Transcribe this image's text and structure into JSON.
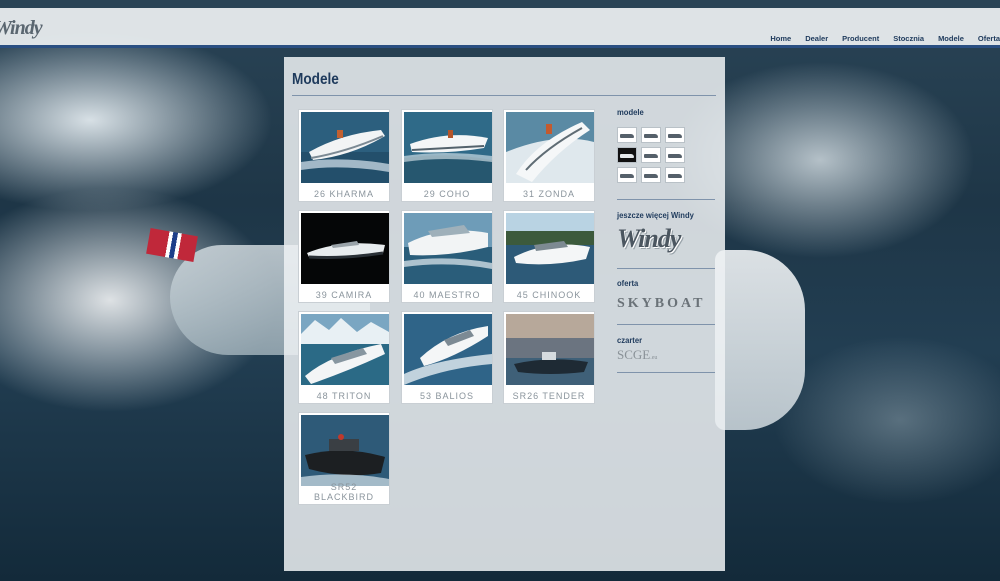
{
  "header": {
    "logo": "Windy",
    "nav": [
      "Home",
      "Dealer",
      "Producent",
      "Stocznia",
      "Modele",
      "Oferta"
    ]
  },
  "page": {
    "title": "Modele"
  },
  "models": [
    {
      "label": "26 KHARMA",
      "scene": "day"
    },
    {
      "label": "29 COHO",
      "scene": "day"
    },
    {
      "label": "31 ZONDA",
      "scene": "light"
    },
    {
      "label": "39 CAMIRA",
      "scene": "dark"
    },
    {
      "label": "40 MAESTRO",
      "scene": "day"
    },
    {
      "label": "45 CHINOOK",
      "scene": "coast"
    },
    {
      "label": "48 TRITON",
      "scene": "ice"
    },
    {
      "label": "53 BALIOS",
      "scene": "day"
    },
    {
      "label": "SR26 TENDER",
      "scene": "harbor"
    },
    {
      "label": "SR52 BLACKBIRD",
      "scene": "dark-sea"
    }
  ],
  "sidebar": {
    "modele_heading": "modele",
    "more_heading": "jeszcze więcej Windy",
    "more_logo": "Windy",
    "offer_heading": "oferta",
    "offer_logo": "SKYBOAT",
    "charter_heading": "czarter",
    "charter_logo": "SCGE",
    "charter_logo_suffix": ".eu"
  },
  "colors": {
    "accent": "#1e3a5c",
    "rule": "#7f93ab",
    "header_border": "#2a4f82"
  }
}
